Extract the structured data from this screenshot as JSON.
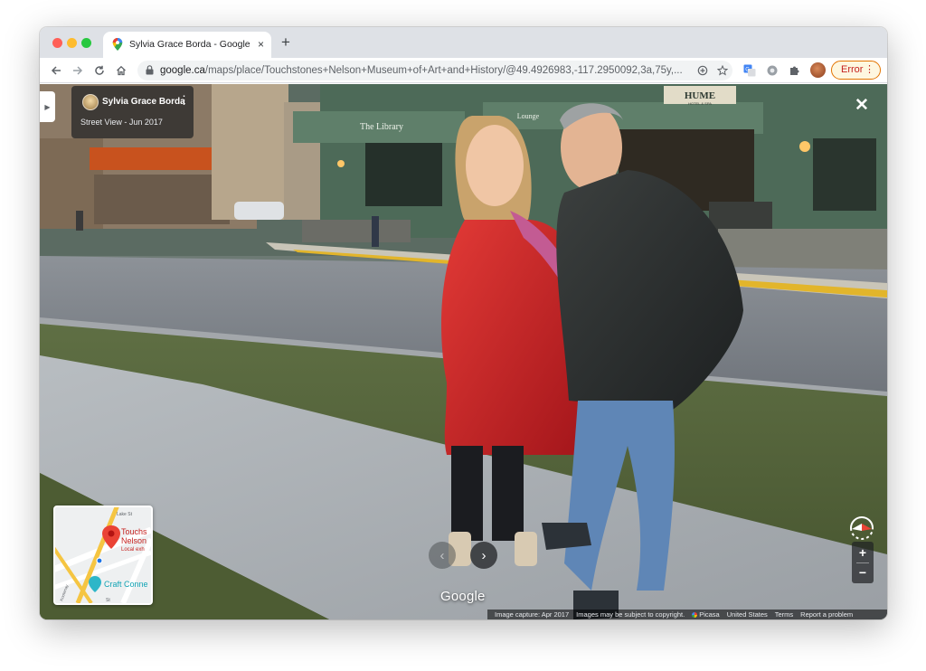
{
  "browser": {
    "tab_title": "Sylvia Grace Borda - Google M",
    "tab_close": "×",
    "new_tab": "+",
    "url_host": "google.ca",
    "url_path": "/maps/place/Touchstones+Nelson+Museum+of+Art+and+History/@49.4926983,-117.2950092,3a,75y,...",
    "error_label": "Error",
    "error_menu": "⋮",
    "icons": [
      "back-icon",
      "forward-icon",
      "reload-icon",
      "home-icon",
      "lock-icon",
      "zoom-plus-icon",
      "star-icon",
      "translate-icon",
      "extension-icon",
      "puzzle-icon",
      "profile-avatar"
    ]
  },
  "streetview": {
    "contributor": "Sylvia Grace Borda",
    "card_menu": "⋮",
    "capture_label": "Street View - Jun 2017",
    "side_toggle": "▶",
    "close": "✕",
    "prev": "‹",
    "next": "›",
    "logo": "Google",
    "zoom_in": "+",
    "zoom_out": "−",
    "minimap": {
      "street_1": "Lake St",
      "place_1a": "Touchs",
      "place_1b": "Nelson",
      "place_1c": "Local exh",
      "place_2": "Craft Conne",
      "street_2": "Kootenay",
      "street_3": "St"
    },
    "scene_signs": {
      "hume": "HUME",
      "hume_sub": "HOTEL & SPA",
      "library": "The Library",
      "lounge": "Lounge"
    },
    "footer": {
      "capture": "Image capture: Apr 2017",
      "copyright": "Images may be subject to copyright.",
      "picasa": "Picasa",
      "country": "United States",
      "terms": "Terms",
      "report": "Report a problem"
    }
  },
  "colors": {
    "accent": "#1a73e8",
    "error": "#c5221f",
    "map_pin": "#ea4335",
    "map_pin_2": "#2eb6c8"
  }
}
